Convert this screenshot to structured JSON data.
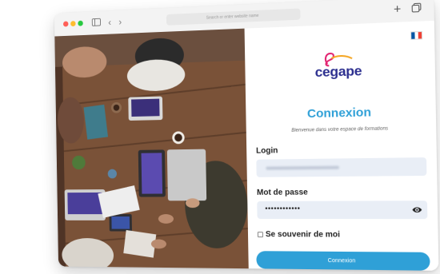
{
  "browser": {
    "address_placeholder": "Search or enter website name",
    "icons": [
      "sidebar-icon",
      "back-icon",
      "forward-icon",
      "plus-icon",
      "tabs-icon"
    ]
  },
  "page": {
    "language_flag": "fr",
    "flag_colors": [
      "#0055a4",
      "#ffffff",
      "#ef4135"
    ],
    "logo_text": "cegape",
    "title": "Connexion",
    "subtitle": "Bienvenue dans votre espace de formations",
    "login_label": "Login",
    "login_value_blurred": true,
    "password_label": "Mot de passe",
    "password_mask": "••••••••••••",
    "remember_label": "Se souvenir de moi",
    "submit_label": "Connexion",
    "accent_color": "#2fa0d7",
    "brand_color": "#2c2f8f"
  }
}
